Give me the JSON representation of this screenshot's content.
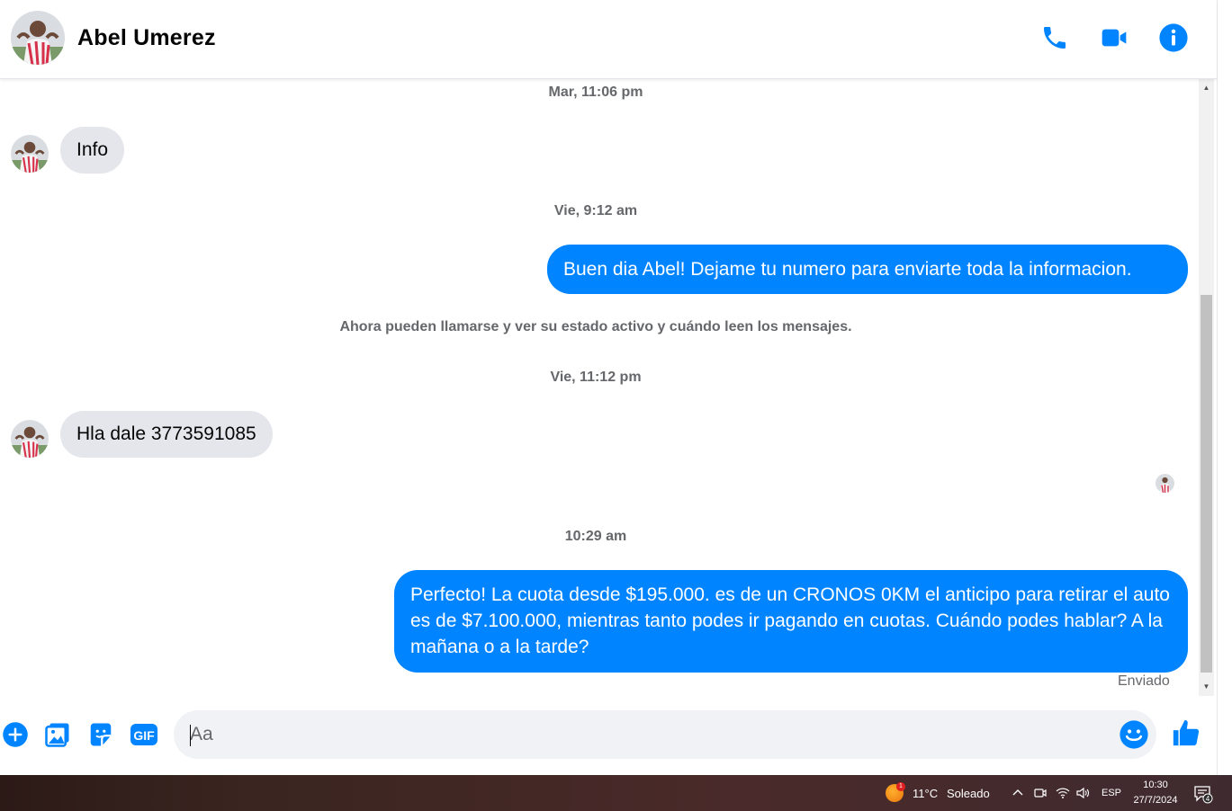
{
  "header": {
    "contact_name": "Abel Umerez",
    "actions": [
      "phone-icon",
      "video-camera-icon",
      "info-icon"
    ]
  },
  "accent_color": "#0084ff",
  "messages": {
    "ts1": "Mar, 11:06 pm",
    "in1": "Info",
    "ts2": "Vie, 9:12 am",
    "out1": "Buen dia Abel! Dejame tu numero para enviarte toda la informacion.",
    "system": "Ahora pueden llamarse y ver su estado activo y cuándo leen los mensajes.",
    "ts3": "Vie, 11:12 pm",
    "in2": "Hla dale 3773591085",
    "ts4": "10:29 am",
    "out2": "Perfecto! La cuota desde $195.000. es de un CRONOS 0KM el anticipo para retirar el auto es de $7.100.000, mientras tanto podes ir pagando en cuotas. Cuándo podes hablar? A la mañana o a la tarde?",
    "status": "Enviado"
  },
  "composer": {
    "placeholder": "Aa",
    "value": "",
    "actions": [
      "plus-circle-icon",
      "photo-icon",
      "sticker-icon",
      "gif-icon",
      "emoji-icon",
      "thumbs-up-icon"
    ],
    "gif_label": "GIF"
  },
  "taskbar": {
    "weather_temp": "11°C",
    "weather_desc": "Soleado",
    "weather_badge": "1",
    "language": "ESP",
    "time": "10:30",
    "date": "27/7/2024",
    "notifications_count": "4"
  }
}
